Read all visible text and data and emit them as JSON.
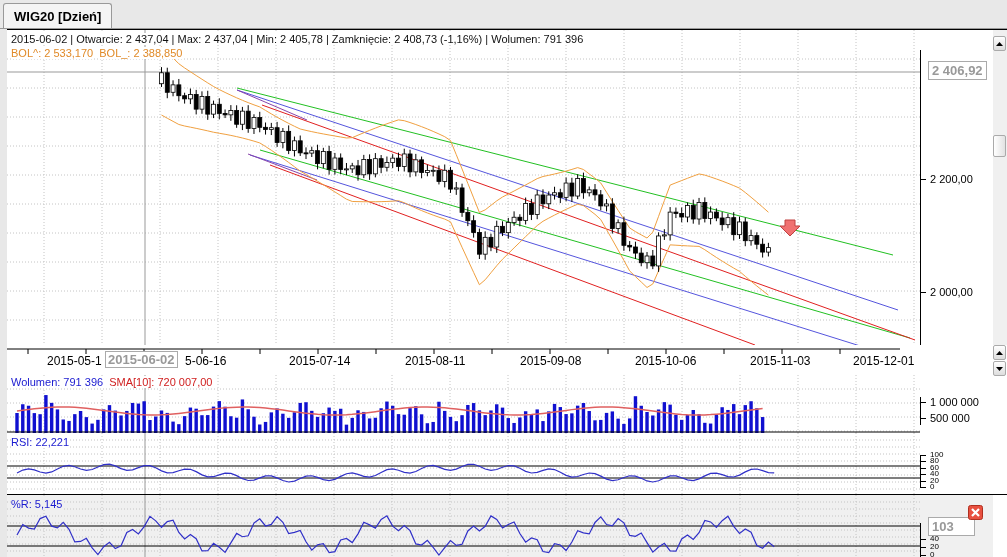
{
  "tab": {
    "label": "WIG20 [Dzień]",
    "selected": true
  },
  "price_pane": {
    "header": "2015-06-02 | Otwarcie: 2 437,04 | Max: 2 437,04 | Min: 2 405,78 | Zamknięcie: 2 408,73 (-1,16%) | Wolumen: 791 396",
    "bollinger": [
      "BOL^: 2 533,170",
      "BOL_: 2 388,850"
    ],
    "crosshair_value": "2 406,92",
    "axis_labels": [
      "2 200,00",
      "2 000,00"
    ]
  },
  "date_axis": {
    "labels": [
      "2015-05-1",
      "5-06-16",
      "2015-07-14",
      "2015-08-11",
      "2015-09-08",
      "2015-10-06",
      "2015-11-03",
      "2015-12-01"
    ],
    "crosshair_date": "2015-06-02"
  },
  "volume_pane": {
    "volume_label": "Wolumen: 791 396",
    "sma_label": "SMA[10]: 720 007,00",
    "axis_labels": [
      "1 000 000",
      "500 000"
    ]
  },
  "rsi_pane": {
    "label": "RSI: 22,221",
    "axis_labels": [
      "100",
      "80",
      "60",
      "40",
      "20",
      "0"
    ]
  },
  "williams_pane": {
    "label": "%R: 5,145",
    "crosshair_value": "103",
    "axis_labels": [
      "40",
      "20",
      "0"
    ]
  }
}
